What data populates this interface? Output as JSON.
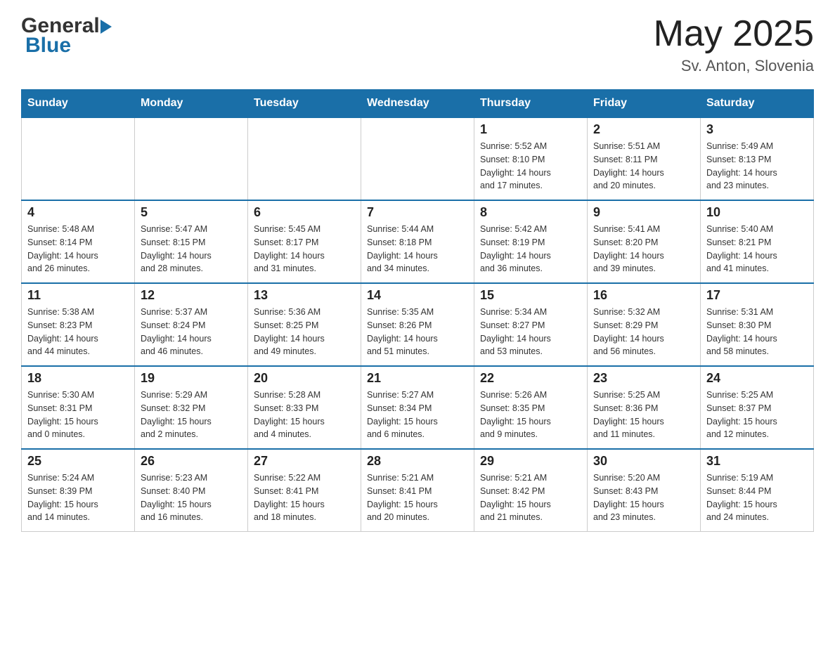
{
  "header": {
    "logo_general": "General",
    "logo_blue": "Blue",
    "month_title": "May 2025",
    "location": "Sv. Anton, Slovenia"
  },
  "calendar": {
    "days_of_week": [
      "Sunday",
      "Monday",
      "Tuesday",
      "Wednesday",
      "Thursday",
      "Friday",
      "Saturday"
    ],
    "weeks": [
      {
        "days": [
          {
            "num": "",
            "info": ""
          },
          {
            "num": "",
            "info": ""
          },
          {
            "num": "",
            "info": ""
          },
          {
            "num": "",
            "info": ""
          },
          {
            "num": "1",
            "info": "Sunrise: 5:52 AM\nSunset: 8:10 PM\nDaylight: 14 hours\nand 17 minutes."
          },
          {
            "num": "2",
            "info": "Sunrise: 5:51 AM\nSunset: 8:11 PM\nDaylight: 14 hours\nand 20 minutes."
          },
          {
            "num": "3",
            "info": "Sunrise: 5:49 AM\nSunset: 8:13 PM\nDaylight: 14 hours\nand 23 minutes."
          }
        ]
      },
      {
        "days": [
          {
            "num": "4",
            "info": "Sunrise: 5:48 AM\nSunset: 8:14 PM\nDaylight: 14 hours\nand 26 minutes."
          },
          {
            "num": "5",
            "info": "Sunrise: 5:47 AM\nSunset: 8:15 PM\nDaylight: 14 hours\nand 28 minutes."
          },
          {
            "num": "6",
            "info": "Sunrise: 5:45 AM\nSunset: 8:17 PM\nDaylight: 14 hours\nand 31 minutes."
          },
          {
            "num": "7",
            "info": "Sunrise: 5:44 AM\nSunset: 8:18 PM\nDaylight: 14 hours\nand 34 minutes."
          },
          {
            "num": "8",
            "info": "Sunrise: 5:42 AM\nSunset: 8:19 PM\nDaylight: 14 hours\nand 36 minutes."
          },
          {
            "num": "9",
            "info": "Sunrise: 5:41 AM\nSunset: 8:20 PM\nDaylight: 14 hours\nand 39 minutes."
          },
          {
            "num": "10",
            "info": "Sunrise: 5:40 AM\nSunset: 8:21 PM\nDaylight: 14 hours\nand 41 minutes."
          }
        ]
      },
      {
        "days": [
          {
            "num": "11",
            "info": "Sunrise: 5:38 AM\nSunset: 8:23 PM\nDaylight: 14 hours\nand 44 minutes."
          },
          {
            "num": "12",
            "info": "Sunrise: 5:37 AM\nSunset: 8:24 PM\nDaylight: 14 hours\nand 46 minutes."
          },
          {
            "num": "13",
            "info": "Sunrise: 5:36 AM\nSunset: 8:25 PM\nDaylight: 14 hours\nand 49 minutes."
          },
          {
            "num": "14",
            "info": "Sunrise: 5:35 AM\nSunset: 8:26 PM\nDaylight: 14 hours\nand 51 minutes."
          },
          {
            "num": "15",
            "info": "Sunrise: 5:34 AM\nSunset: 8:27 PM\nDaylight: 14 hours\nand 53 minutes."
          },
          {
            "num": "16",
            "info": "Sunrise: 5:32 AM\nSunset: 8:29 PM\nDaylight: 14 hours\nand 56 minutes."
          },
          {
            "num": "17",
            "info": "Sunrise: 5:31 AM\nSunset: 8:30 PM\nDaylight: 14 hours\nand 58 minutes."
          }
        ]
      },
      {
        "days": [
          {
            "num": "18",
            "info": "Sunrise: 5:30 AM\nSunset: 8:31 PM\nDaylight: 15 hours\nand 0 minutes."
          },
          {
            "num": "19",
            "info": "Sunrise: 5:29 AM\nSunset: 8:32 PM\nDaylight: 15 hours\nand 2 minutes."
          },
          {
            "num": "20",
            "info": "Sunrise: 5:28 AM\nSunset: 8:33 PM\nDaylight: 15 hours\nand 4 minutes."
          },
          {
            "num": "21",
            "info": "Sunrise: 5:27 AM\nSunset: 8:34 PM\nDaylight: 15 hours\nand 6 minutes."
          },
          {
            "num": "22",
            "info": "Sunrise: 5:26 AM\nSunset: 8:35 PM\nDaylight: 15 hours\nand 9 minutes."
          },
          {
            "num": "23",
            "info": "Sunrise: 5:25 AM\nSunset: 8:36 PM\nDaylight: 15 hours\nand 11 minutes."
          },
          {
            "num": "24",
            "info": "Sunrise: 5:25 AM\nSunset: 8:37 PM\nDaylight: 15 hours\nand 12 minutes."
          }
        ]
      },
      {
        "days": [
          {
            "num": "25",
            "info": "Sunrise: 5:24 AM\nSunset: 8:39 PM\nDaylight: 15 hours\nand 14 minutes."
          },
          {
            "num": "26",
            "info": "Sunrise: 5:23 AM\nSunset: 8:40 PM\nDaylight: 15 hours\nand 16 minutes."
          },
          {
            "num": "27",
            "info": "Sunrise: 5:22 AM\nSunset: 8:41 PM\nDaylight: 15 hours\nand 18 minutes."
          },
          {
            "num": "28",
            "info": "Sunrise: 5:21 AM\nSunset: 8:41 PM\nDaylight: 15 hours\nand 20 minutes."
          },
          {
            "num": "29",
            "info": "Sunrise: 5:21 AM\nSunset: 8:42 PM\nDaylight: 15 hours\nand 21 minutes."
          },
          {
            "num": "30",
            "info": "Sunrise: 5:20 AM\nSunset: 8:43 PM\nDaylight: 15 hours\nand 23 minutes."
          },
          {
            "num": "31",
            "info": "Sunrise: 5:19 AM\nSunset: 8:44 PM\nDaylight: 15 hours\nand 24 minutes."
          }
        ]
      }
    ]
  }
}
